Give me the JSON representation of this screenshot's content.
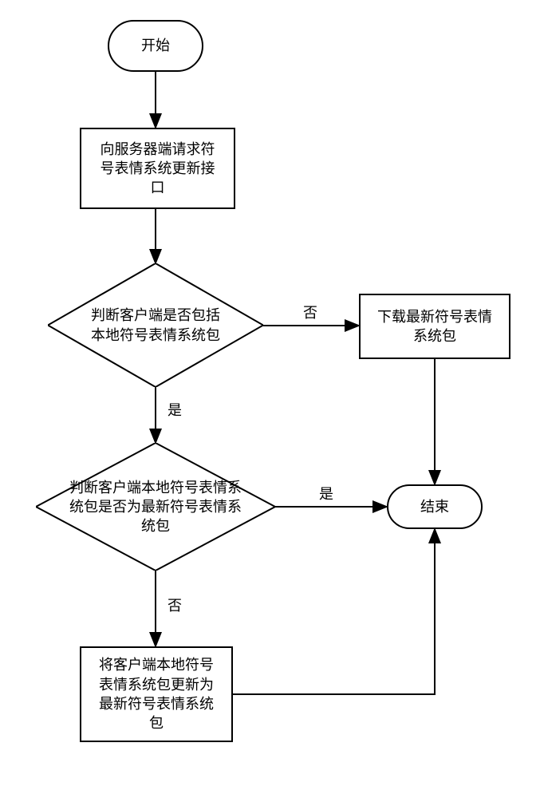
{
  "chart_data": {
    "type": "flowchart",
    "nodes": [
      {
        "id": "start",
        "shape": "terminator",
        "text": "开始"
      },
      {
        "id": "request",
        "shape": "process",
        "text": "向服务器端请求符号表情系统更新接口"
      },
      {
        "id": "hasLocal",
        "shape": "decision",
        "text": "判断客户端是否包括本地符号表情系统包"
      },
      {
        "id": "download",
        "shape": "process",
        "text": "下载最新符号表情系统包"
      },
      {
        "id": "isLatest",
        "shape": "decision",
        "text": "判断客户端本地符号表情系统包是否为最新符号表情系统包"
      },
      {
        "id": "update",
        "shape": "process",
        "text": "将客户端本地符号表情系统包更新为最新符号表情系统包"
      },
      {
        "id": "end",
        "shape": "terminator",
        "text": "结束"
      }
    ],
    "edges": [
      {
        "from": "start",
        "to": "request"
      },
      {
        "from": "request",
        "to": "hasLocal"
      },
      {
        "from": "hasLocal",
        "to": "download",
        "label": "否"
      },
      {
        "from": "hasLocal",
        "to": "isLatest",
        "label": "是"
      },
      {
        "from": "isLatest",
        "to": "end",
        "label": "是"
      },
      {
        "from": "isLatest",
        "to": "update",
        "label": "否"
      },
      {
        "from": "download",
        "to": "end"
      },
      {
        "from": "update",
        "to": "end"
      }
    ]
  },
  "labels": {
    "start": "开始",
    "request": "向服务器端请求符\n号表情系统更新接\n口",
    "hasLocal": "判断客户端是否包括\n本地符号表情系统包",
    "download": "下载最新符号表情\n系统包",
    "isLatest": "判断客户端本地符号表情系\n统包是否为最新符号表情系\n统包",
    "update": "将客户端本地符号\n表情系统包更新为\n最新符号表情系统\n包",
    "end": "结束",
    "yes": "是",
    "no": "否"
  }
}
